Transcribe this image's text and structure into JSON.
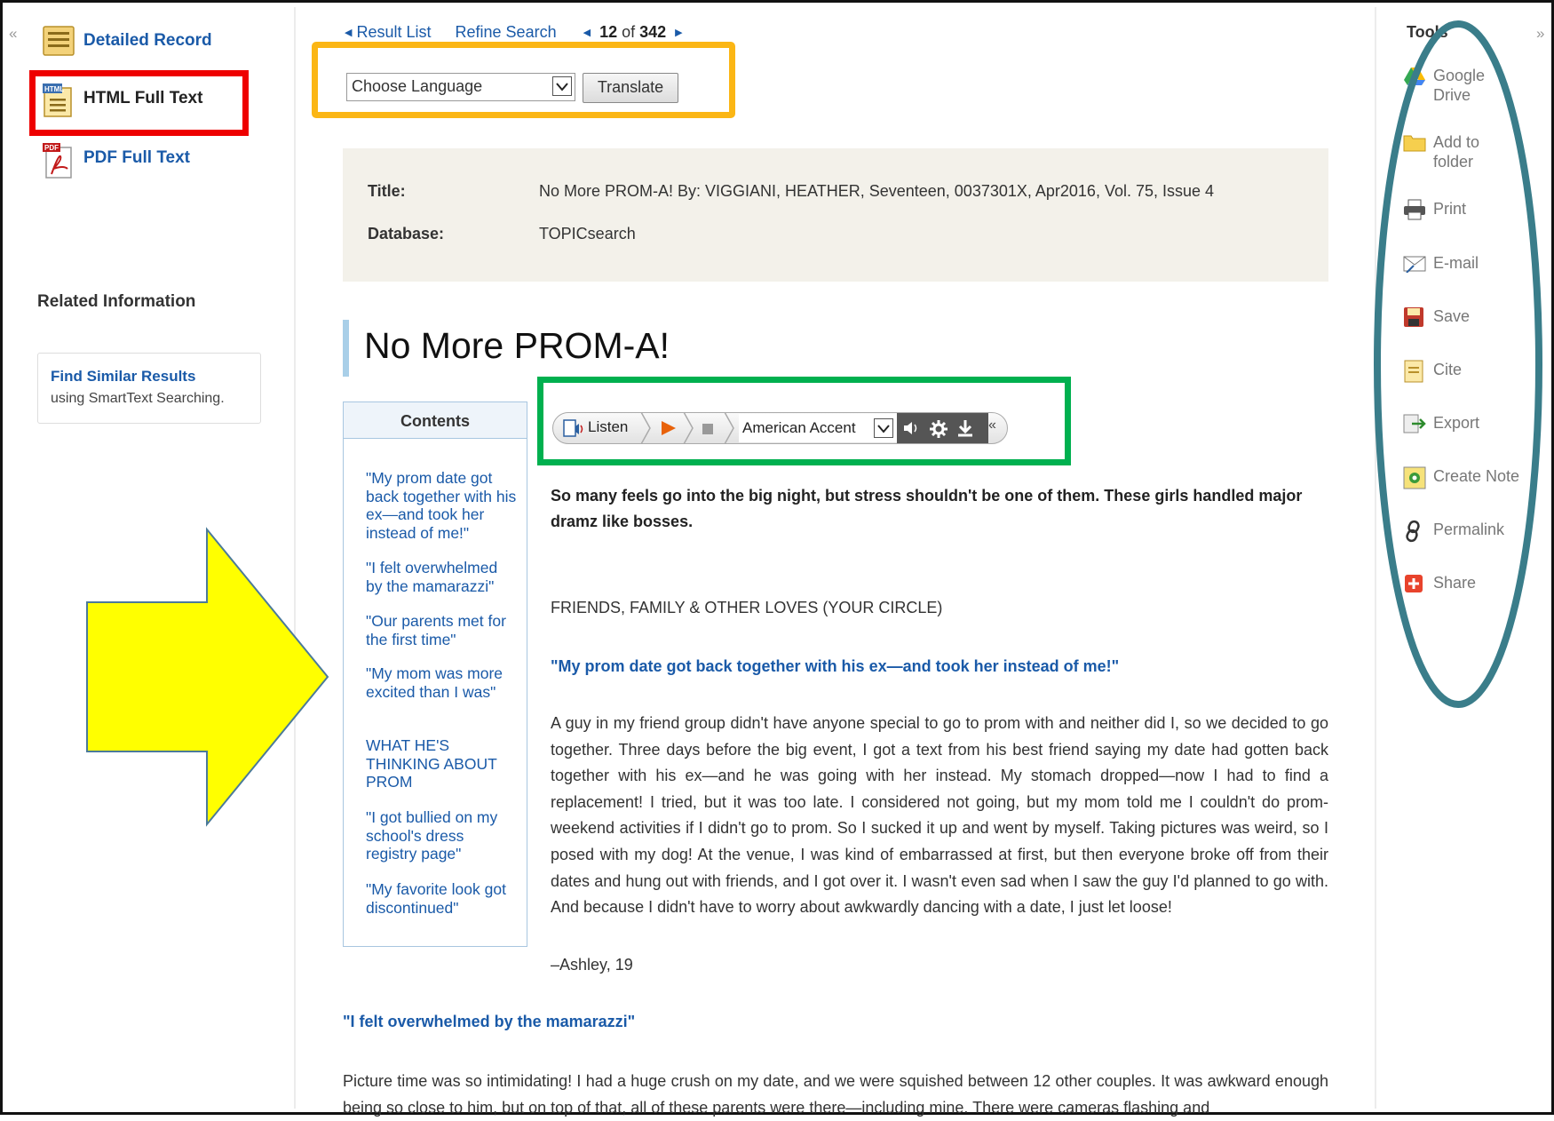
{
  "left_panel": {
    "collapse_glyph": "«",
    "nav": [
      {
        "label": "Detailed Record"
      },
      {
        "label": "HTML Full Text",
        "icon_text": "HTML"
      },
      {
        "label": "PDF Full Text",
        "icon_text": "PDF"
      }
    ],
    "related_title": "Related Information",
    "find_similar": {
      "title": "Find Similar Results",
      "subtitle": "using SmartText Searching."
    }
  },
  "top_nav": {
    "result_list": "Result List",
    "refine_search": "Refine Search",
    "position": "12",
    "of_label": "of",
    "total": "342"
  },
  "translate": {
    "selected": "Choose Language",
    "button": "Translate"
  },
  "record": {
    "title_label": "Title:",
    "title_value": "No More PROM-A! By: VIGGIANI, HEATHER, Seventeen, 0037301X, Apr2016, Vol. 75, Issue 4",
    "database_label": "Database:",
    "database_value": "TOPICsearch"
  },
  "article": {
    "heading": "No More PROM-A!",
    "lead": "So many feels go into the big night, but stress shouldn't be one of them. These girls handled major dramz like bosses.",
    "section": "FRIENDS, FAMILY & OTHER LOVES (YOUR CIRCLE)",
    "sub1": "\"My prom date got back together with his ex—and took her instead of me!\"",
    "para1": "A guy in my friend group didn't have anyone special to go to prom with and neither did I, so we decided to go together. Three days before the big event, I got a text from his best friend saying my date had gotten back together with his ex—and he was going with her instead. My stomach dropped—now I had to find a replacement! I tried, but it was too late. I considered not going, but my mom told me I couldn't do prom-weekend activities if I didn't go to prom. So I sucked it up and went by myself. Taking pictures was weird, so I posed with my dog! At the venue, I was kind of embarrassed at first, but then everyone broke off from their dates and hung out with friends, and I got over it. I wasn't even sad when I saw the guy I'd planned to go with. And because I didn't have to worry about awkwardly dancing with a date, I just let loose!",
    "signature": "–Ashley, 19",
    "sub2": "\"I felt overwhelmed by the mamarazzi\"",
    "para2": "Picture time was so intimidating! I had a huge crush on my date, and we were squished between 12 other couples. It was awkward enough being so close to him, but on top of that, all of these parents were there—including mine. There were cameras flashing and"
  },
  "contents": {
    "header": "Contents",
    "items": [
      "\"My prom date got back together with his ex—and took her instead of me!\"",
      "\"I felt overwhelmed by the mamarazzi\"",
      "\"Our parents met for the first time\"",
      "\"My mom was more excited than I was\"",
      "WHAT HE'S THINKING ABOUT PROM",
      "\"I got bullied on my school's dress registry page\"",
      "\"My favorite look got discontinued\""
    ]
  },
  "listen_bar": {
    "listen_label": "Listen",
    "accent": "American Accent",
    "collapse_glyph": "«"
  },
  "tools": {
    "title": "Tools",
    "collapse_glyph": "»",
    "items": [
      {
        "label": "Google Drive",
        "icon": "google-drive-icon"
      },
      {
        "label": "Add to folder",
        "icon": "folder-icon"
      },
      {
        "label": "Print",
        "icon": "printer-icon"
      },
      {
        "label": "E-mail",
        "icon": "email-icon"
      },
      {
        "label": "Save",
        "icon": "save-icon"
      },
      {
        "label": "Cite",
        "icon": "cite-icon"
      },
      {
        "label": "Export",
        "icon": "export-icon"
      },
      {
        "label": "Create Note",
        "icon": "note-icon"
      },
      {
        "label": "Permalink",
        "icon": "link-icon"
      },
      {
        "label": "Share",
        "icon": "share-icon"
      }
    ]
  },
  "annotation_colors": {
    "red_box": "#ee0000",
    "orange_box": "#fbb615",
    "green_box": "#00b04f",
    "teal_ellipse": "#3a7d8a",
    "yellow_arrow": "#ffff00",
    "link_blue": "#1a5aa8"
  }
}
